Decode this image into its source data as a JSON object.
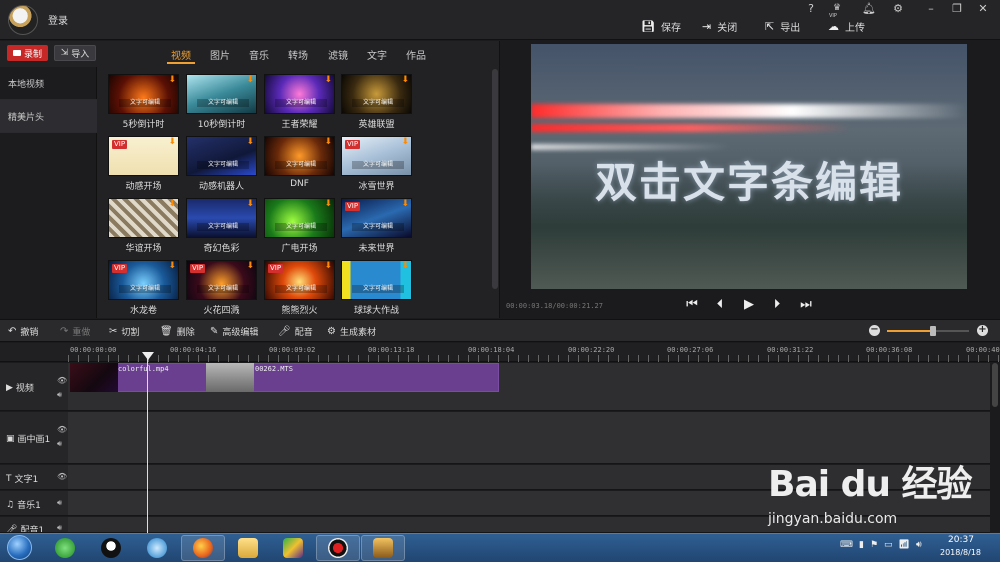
{
  "titlebar": {
    "login": "登录",
    "help": "?",
    "vip": "VIP",
    "actions": {
      "save": "保存",
      "close": "关闭",
      "export": "导出",
      "upload": "上传"
    }
  },
  "left": {
    "record": "录制",
    "import": "导入",
    "tabs": [
      "视频",
      "图片",
      "音乐",
      "转场",
      "滤镜",
      "文字",
      "作品"
    ],
    "active_tab": "视频",
    "side_items": [
      "本地视频",
      "精美片头"
    ],
    "templates": [
      {
        "label": "5秒倒计时",
        "vip": false,
        "caption": "文字可编辑"
      },
      {
        "label": "10秒倒计时",
        "vip": false,
        "caption": "文字可编辑"
      },
      {
        "label": "王者荣耀",
        "vip": false,
        "caption": "文字可编辑"
      },
      {
        "label": "英雄联盟",
        "vip": false,
        "caption": "文字可编辑"
      },
      {
        "label": "动感开场",
        "vip": true,
        "caption": ""
      },
      {
        "label": "动感机器人",
        "vip": false,
        "caption": "文字可编辑"
      },
      {
        "label": "DNF",
        "vip": false,
        "caption": "文字可编辑"
      },
      {
        "label": "冰雪世界",
        "vip": true,
        "caption": "文字可编辑"
      },
      {
        "label": "华谊开场",
        "vip": false,
        "caption": ""
      },
      {
        "label": "奇幻色彩",
        "vip": false,
        "caption": "文字可编辑"
      },
      {
        "label": "广电开场",
        "vip": false,
        "caption": "文字可编辑"
      },
      {
        "label": "未来世界",
        "vip": true,
        "caption": "文字可编辑"
      },
      {
        "label": "水龙卷",
        "vip": true,
        "caption": "文字可编辑"
      },
      {
        "label": "火花四溅",
        "vip": true,
        "caption": "文字可编辑"
      },
      {
        "label": "熊熊烈火",
        "vip": true,
        "caption": "文字可编辑"
      },
      {
        "label": "球球大作战",
        "vip": false,
        "caption": "文字可编辑"
      }
    ],
    "vip_badge": "VIP"
  },
  "preview": {
    "title": "双击文字条编辑",
    "time": "00:00:03.18/00:00:21.27"
  },
  "toolbar": {
    "undo": "撤销",
    "redo": "重做",
    "cut": "切割",
    "delete": "删除",
    "advanced": "高级编辑",
    "dub": "配音",
    "generate": "生成素材"
  },
  "timeline": {
    "ticks": [
      "00:00:00:00",
      "00:00:04:16",
      "00:00:09:02",
      "00:00:13:18",
      "00:00:18:04",
      "00:00:22:20",
      "00:00:27:06",
      "00:00:31:22",
      "00:00:36:08",
      "00:00:40"
    ],
    "tracks": [
      "视频",
      "画中画1",
      "文字1",
      "音乐1",
      "配音1"
    ],
    "clips": [
      {
        "name": "colorful.mp4"
      },
      {
        "name": "00262.MTS"
      }
    ]
  },
  "taskbar": {
    "time": "20:37",
    "date": "2018/8/18"
  },
  "watermark": {
    "logo": "Bai du 经验",
    "url": "jingyan.baidu.com"
  },
  "colors": {
    "accent": "#f0a030",
    "record": "#c62828",
    "clip": "#6a3f8f"
  }
}
